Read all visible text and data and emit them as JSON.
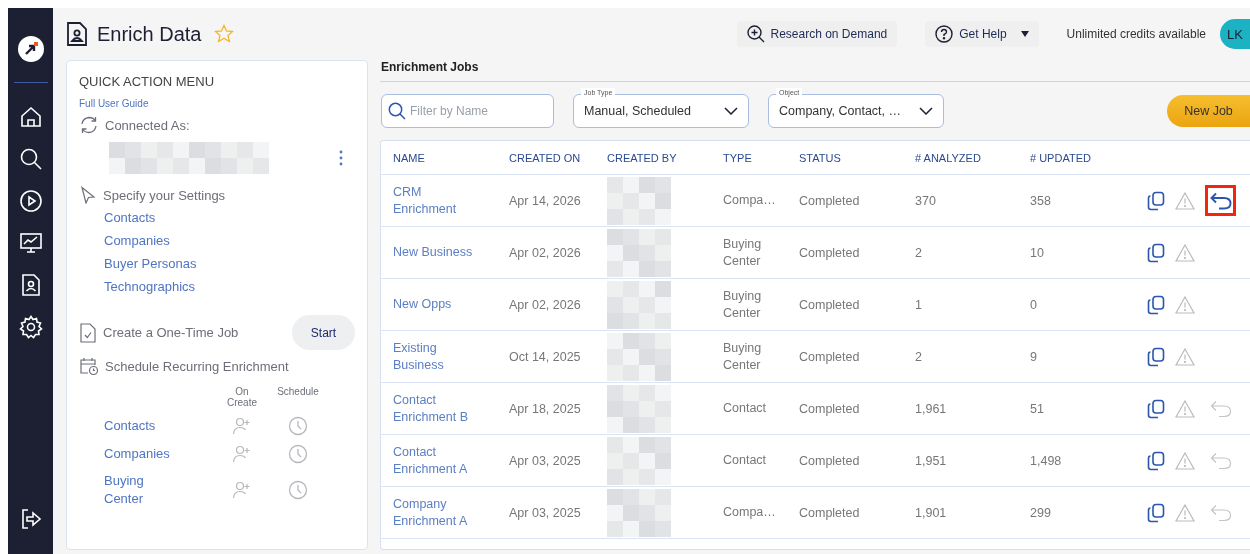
{
  "page": {
    "title": "Enrich Data",
    "favorite": false
  },
  "top_bar": {
    "research_button": "Research on Demand",
    "help_button": "Get Help",
    "credits": "Unlimited credits available",
    "avatar": "LK"
  },
  "quick_menu": {
    "title": "QUICK ACTION MENU",
    "guide_link": "Full User Guide",
    "connected_label": "Connected As:",
    "settings_label": "Specify your Settings",
    "settings_links": [
      "Contacts",
      "Companies",
      "Buyer Personas",
      "Technographics"
    ],
    "one_time_label": "Create a One-Time Job",
    "start_button": "Start",
    "schedule_label": "Schedule Recurring Enrichment",
    "schedule_columns": [
      "On Create",
      "Schedule"
    ],
    "schedule_rows": [
      "Contacts",
      "Companies",
      "Buying Center"
    ]
  },
  "jobs": {
    "title": "Enrichment Jobs",
    "filter_placeholder": "Filter by Name",
    "job_type": {
      "label": "Job Type",
      "value": "Manual, Scheduled"
    },
    "object": {
      "label": "Object",
      "value": "Company, Contact, …"
    },
    "new_job_button": "New Job",
    "columns": [
      "NAME",
      "CREATED ON",
      "CREATED BY",
      "TYPE",
      "STATUS",
      "# ANALYZED",
      "# UPDATED"
    ],
    "rows": [
      {
        "name": "CRM Enrichment",
        "created_on": "Apr 14, 2026",
        "type": "Compa…",
        "status": "Completed",
        "analyzed": "370",
        "updated": "358",
        "undo_available": true,
        "undo_enabled": true,
        "highlighted": true
      },
      {
        "name": "New Business",
        "created_on": "Apr 02, 2026",
        "type": "Buying Center",
        "status": "Completed",
        "analyzed": "2",
        "updated": "10",
        "undo_available": false,
        "highlighted": false
      },
      {
        "name": "New Opps",
        "created_on": "Apr 02, 2026",
        "type": "Buying Center",
        "status": "Completed",
        "analyzed": "1",
        "updated": "0",
        "undo_available": false,
        "highlighted": false
      },
      {
        "name": "Existing Business",
        "created_on": "Oct 14, 2025",
        "type": "Buying Center",
        "status": "Completed",
        "analyzed": "2",
        "updated": "9",
        "undo_available": false,
        "highlighted": false
      },
      {
        "name": "Contact Enrichment B",
        "created_on": "Apr 18, 2025",
        "type": "Contact",
        "status": "Completed",
        "analyzed": "1,961",
        "updated": "51",
        "undo_available": true,
        "undo_enabled": false,
        "highlighted": false
      },
      {
        "name": "Contact Enrichment A",
        "created_on": "Apr 03, 2025",
        "type": "Contact",
        "status": "Completed",
        "analyzed": "1,951",
        "updated": "1,498",
        "undo_available": true,
        "undo_enabled": false,
        "highlighted": false
      },
      {
        "name": "Company Enrichment A",
        "created_on": "Apr 03, 2025",
        "type": "Compa…",
        "status": "Completed",
        "analyzed": "1,901",
        "updated": "299",
        "undo_available": true,
        "undo_enabled": false,
        "highlighted": false
      }
    ]
  }
}
